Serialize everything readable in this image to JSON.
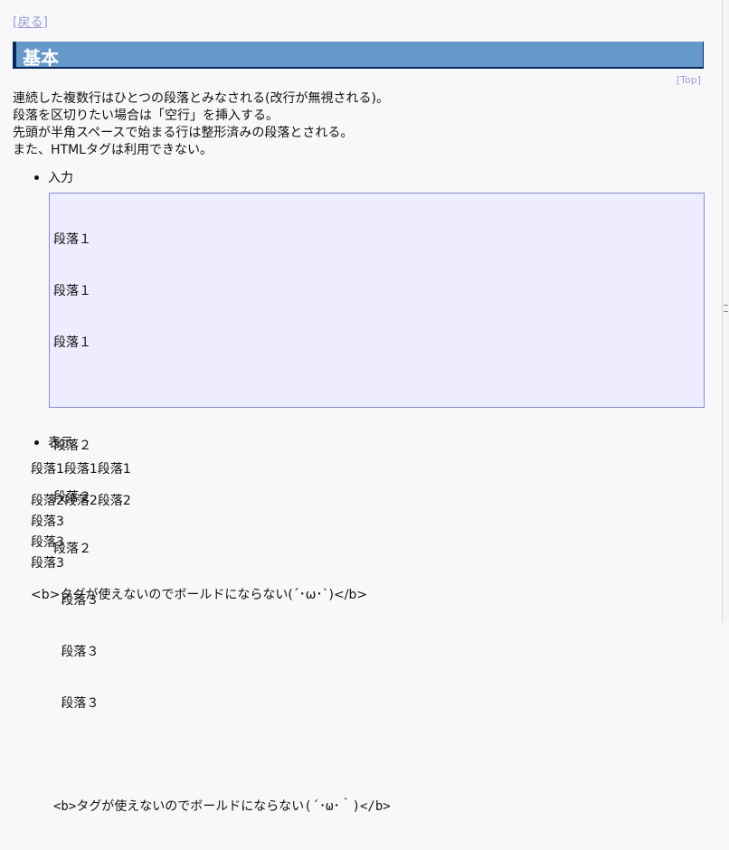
{
  "nav": {
    "back_label": "[戻る]"
  },
  "section": {
    "title": "基本",
    "top_link": "[Top]"
  },
  "intro": [
    "連続した複数行はひとつの段落とみなされる(改行が無視される)。",
    "段落を区切りたい場合は「空行」を挿入する。",
    "先頭が半角スペースで始まる行は整形済みの段落とされる。",
    "また、HTMLタグは利用できない。"
  ],
  "input_section": {
    "label": "入力",
    "lines": [
      "段落１",
      "段落１",
      "段落１",
      "",
      "段落２",
      "段落２",
      "段落２",
      " 段落３",
      " 段落３",
      " 段落３",
      "",
      "<b>タグが使えないのでボールドにならない(´･ω･｀)</b>"
    ]
  },
  "display_section": {
    "label": "表示",
    "lines": [
      "段落1段落1段落1",
      "",
      "段落2段落2段落2",
      "段落3",
      "段落3",
      "段落3",
      "",
      "<b>タグが使えないのでボールドにならない(´･ω･`)</b>"
    ]
  },
  "colors": {
    "heading_bg": "#6698cc",
    "heading_border": "#0b2a5c",
    "link": "#9b9bd6",
    "pre_bg": "#ededff",
    "pre_border": "#8a8ad0"
  }
}
